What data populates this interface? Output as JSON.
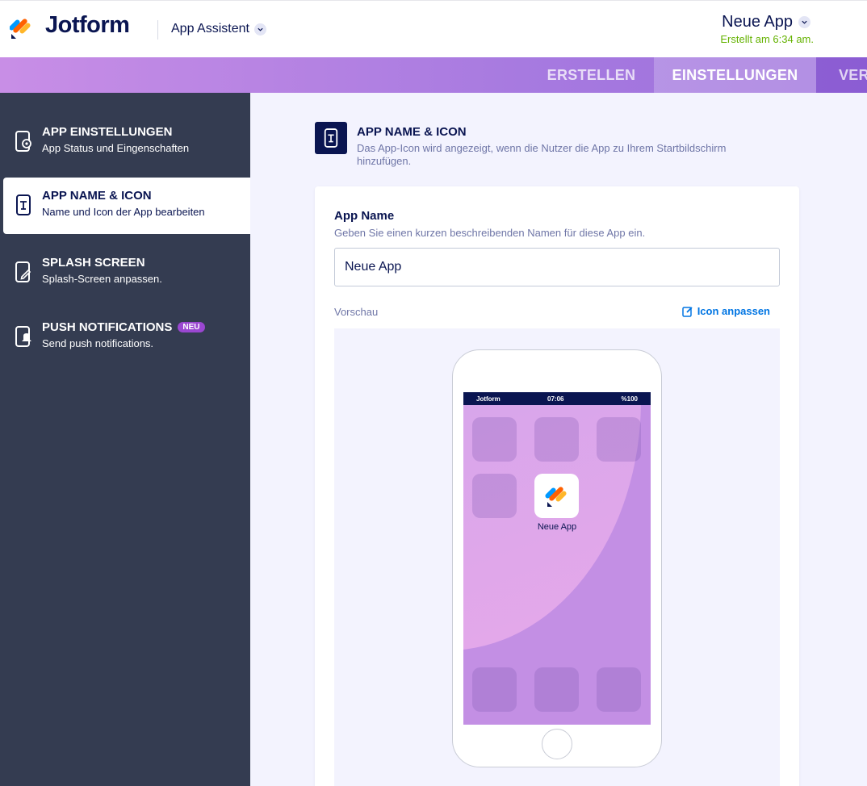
{
  "header": {
    "brand": "Jotform",
    "assistant_label": "App Assistent",
    "app_name": "Neue App",
    "created_text": "Erstellt am 6:34 am."
  },
  "nav": {
    "tabs": [
      {
        "label": "ERSTELLEN",
        "active": false
      },
      {
        "label": "EINSTELLUNGEN",
        "active": true
      },
      {
        "label": "VER",
        "active": false
      }
    ]
  },
  "sidebar": {
    "items": [
      {
        "title": "APP EINSTELLUNGEN",
        "subtitle": "App Status und Eingenschaften",
        "icon": "phone-gear-icon",
        "active": false
      },
      {
        "title": "APP NAME & ICON",
        "subtitle": "Name und Icon der App bearbeiten",
        "icon": "phone-text-icon",
        "active": true
      },
      {
        "title": "SPLASH SCREEN",
        "subtitle": "Splash-Screen anpassen.",
        "icon": "phone-edit-icon",
        "active": false
      },
      {
        "title": "PUSH NOTIFICATIONS",
        "subtitle": "Send push notifications.",
        "icon": "phone-bell-icon",
        "active": false,
        "badge": "NEU"
      }
    ]
  },
  "section": {
    "title": "APP NAME & ICON",
    "description": "Das App-Icon wird angezeigt, wenn die Nutzer die App zu Ihrem Startbildschirm hinzufügen."
  },
  "form": {
    "label": "App Name",
    "help": "Geben Sie einen kurzen beschreibenden Namen für diese App ein.",
    "value": "Neue App",
    "preview_label": "Vorschau",
    "customize_label": "Icon anpassen"
  },
  "phone": {
    "status_brand": "Jotform",
    "status_time": "07:06",
    "status_battery": "%100",
    "app_label": "Neue App"
  },
  "colors": {
    "navy": "#0a1551",
    "sidebar": "#343c51",
    "accent_blue": "#0075e3",
    "created_green": "#64b200",
    "badge_purple": "#9a47d1"
  }
}
